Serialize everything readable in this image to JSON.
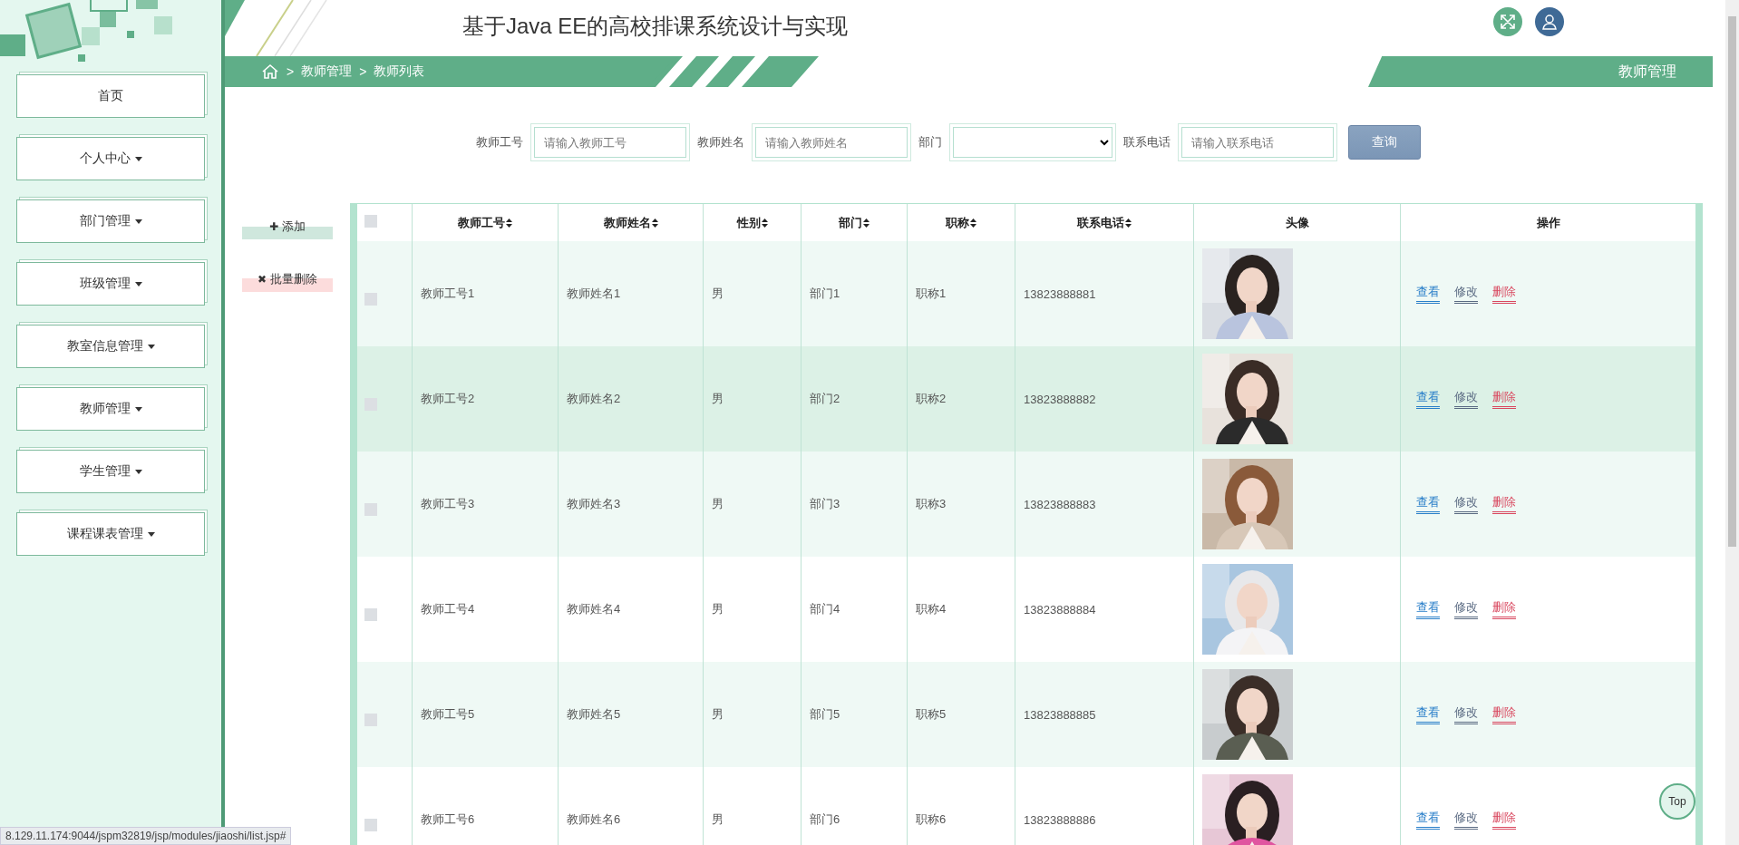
{
  "header": {
    "title": "基于Java EE的高校排课系统设计与实现",
    "section_tab": "教师管理"
  },
  "breadcrumb": [
    {
      "separator": ">",
      "label": "教师管理"
    },
    {
      "separator": ">",
      "label": "教师列表"
    }
  ],
  "sidebar": {
    "items": [
      {
        "label": "首页",
        "dropdown": false
      },
      {
        "label": "个人中心",
        "dropdown": true
      },
      {
        "label": "部门管理",
        "dropdown": true
      },
      {
        "label": "班级管理",
        "dropdown": true
      },
      {
        "label": "教室信息管理",
        "dropdown": true
      },
      {
        "label": "教师管理",
        "dropdown": true
      },
      {
        "label": "学生管理",
        "dropdown": true
      },
      {
        "label": "课程课表管理",
        "dropdown": true
      }
    ]
  },
  "search": {
    "fields": [
      {
        "kind": "text",
        "label": "教师工号",
        "placeholder": "请输入教师工号"
      },
      {
        "kind": "text",
        "label": "教师姓名",
        "placeholder": "请输入教师姓名"
      },
      {
        "kind": "select",
        "label": "部门"
      },
      {
        "kind": "text",
        "label": "联系电话",
        "placeholder": "请输入联系电话"
      }
    ],
    "button": "查询"
  },
  "actions": [
    {
      "kind": "add",
      "icon": "✚",
      "label": "添加"
    },
    {
      "kind": "delete",
      "icon": "✖",
      "label": "批量删除"
    }
  ],
  "table": {
    "header_checked": false,
    "columns": [
      {
        "label": "教师工号",
        "sortable": true
      },
      {
        "label": "教师姓名",
        "sortable": true
      },
      {
        "label": "性别",
        "sortable": true
      },
      {
        "label": "部门",
        "sortable": true
      },
      {
        "label": "职称",
        "sortable": true
      },
      {
        "label": "联系电话",
        "sortable": true
      },
      {
        "label": "头像",
        "sortable": false
      },
      {
        "label": "操作",
        "sortable": false
      }
    ],
    "rows": [
      {
        "checked": false,
        "highlighted": false,
        "cells": [
          "教师工号1",
          "教师姓名1",
          "男",
          "部门1",
          "职称1",
          "13823888881"
        ],
        "photo": {
          "kind": "picture"
        },
        "links": [
          {
            "kind": "view",
            "label": "查看"
          },
          {
            "kind": "edit",
            "label": "修改"
          },
          {
            "kind": "delete",
            "label": "删除"
          }
        ]
      },
      {
        "checked": false,
        "highlighted": true,
        "cells": [
          "教师工号2",
          "教师姓名2",
          "男",
          "部门2",
          "职称2",
          "13823888882"
        ],
        "photo": {
          "kind": "picture"
        },
        "links": [
          {
            "kind": "view",
            "label": "查看"
          },
          {
            "kind": "edit",
            "label": "修改"
          },
          {
            "kind": "delete",
            "label": "删除"
          }
        ]
      },
      {
        "checked": false,
        "highlighted": false,
        "cells": [
          "教师工号3",
          "教师姓名3",
          "男",
          "部门3",
          "职称3",
          "13823888883"
        ],
        "photo": {
          "kind": "picture"
        },
        "links": [
          {
            "kind": "view",
            "label": "查看"
          },
          {
            "kind": "edit",
            "label": "修改"
          },
          {
            "kind": "delete",
            "label": "删除"
          }
        ]
      },
      {
        "checked": false,
        "highlighted": false,
        "cells": [
          "教师工号4",
          "教师姓名4",
          "男",
          "部门4",
          "职称4",
          "13823888884"
        ],
        "photo": {
          "kind": "picture"
        },
        "links": [
          {
            "kind": "view",
            "label": "查看"
          },
          {
            "kind": "edit",
            "label": "修改"
          },
          {
            "kind": "delete",
            "label": "删除"
          }
        ]
      },
      {
        "checked": false,
        "highlighted": false,
        "cells": [
          "教师工号5",
          "教师姓名5",
          "男",
          "部门5",
          "职称5",
          "13823888885"
        ],
        "photo": {
          "kind": "picture"
        },
        "links": [
          {
            "kind": "view",
            "label": "查看"
          },
          {
            "kind": "edit",
            "label": "修改"
          },
          {
            "kind": "delete",
            "label": "删除"
          }
        ]
      },
      {
        "checked": false,
        "highlighted": false,
        "cells": [
          "教师工号6",
          "教师姓名6",
          "男",
          "部门6",
          "职称6",
          "13823888886"
        ],
        "photo": {
          "kind": "picture"
        },
        "links": [
          {
            "kind": "view",
            "label": "查看"
          },
          {
            "kind": "edit",
            "label": "修改"
          },
          {
            "kind": "delete",
            "label": "删除"
          }
        ]
      }
    ]
  },
  "top_button": "Top",
  "status_url": "8.129.11.174:9044/jspm32819/jsp/modules/jiaoshi/list.jsp#"
}
